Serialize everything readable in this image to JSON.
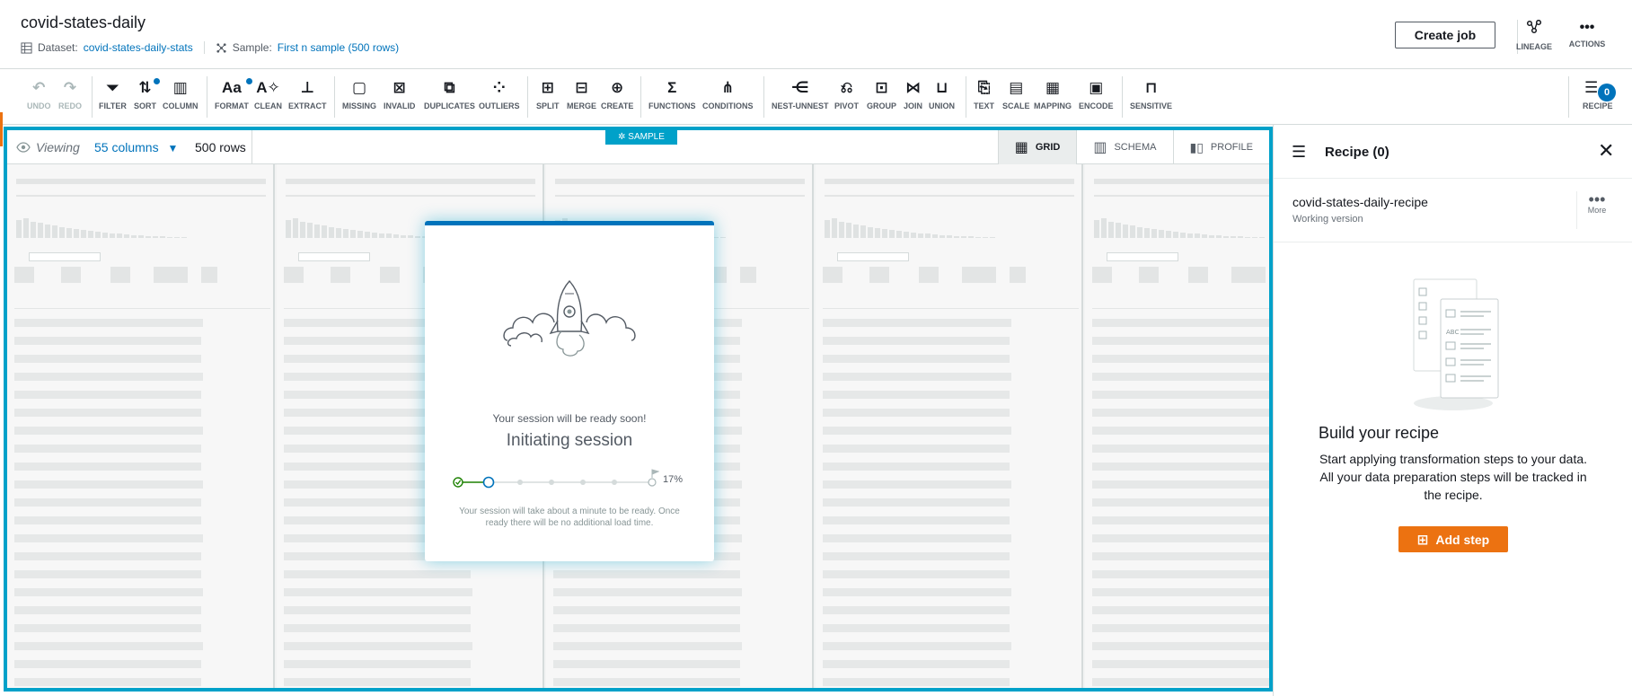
{
  "header": {
    "title": "covid-states-daily",
    "dataset_label": "Dataset:",
    "dataset_value": "covid-states-daily-stats",
    "sample_label": "Sample:",
    "sample_value": "First n sample (500 rows)",
    "create_job": "Create job",
    "lineage": "LINEAGE",
    "actions": "ACTIONS"
  },
  "toolbar": {
    "undo": "UNDO",
    "redo": "REDO",
    "filter": "FILTER",
    "sort": "SORT",
    "column": "COLUMN",
    "format": "FORMAT",
    "clean": "CLEAN",
    "extract": "EXTRACT",
    "missing": "MISSING",
    "invalid": "INVALID",
    "duplicates": "DUPLICATES",
    "outliers": "OUTLIERS",
    "split": "SPLIT",
    "merge": "MERGE",
    "create": "CREATE",
    "functions": "FUNCTIONS",
    "conditions": "CONDITIONS",
    "nest_unnest": "NEST-UNNEST",
    "pivot": "PIVOT",
    "group": "GROUP",
    "join": "JOIN",
    "union": "UNION",
    "text": "TEXT",
    "scale": "SCALE",
    "mapping": "MAPPING",
    "encode": "ENCODE",
    "sensitive": "SENSITIVE",
    "recipe": "RECIPE",
    "recipe_count": "0"
  },
  "grid": {
    "viewing": "Viewing",
    "columns": "55 columns",
    "rows": "500 rows",
    "sample_tag": "SAMPLE",
    "tabs": [
      "GRID",
      "SCHEMA",
      "PROFILE"
    ],
    "active_tab": "GRID"
  },
  "session": {
    "ready_text": "Your session will be ready soon!",
    "state": "Initiating session",
    "progress": "17%",
    "progress_fraction": 0.17,
    "note": "Your session will take about a minute to be ready. Once ready there will be no additional load time."
  },
  "recipe": {
    "title": "Recipe (0)",
    "name": "covid-states-daily-recipe",
    "version": "Working version",
    "more": "More",
    "build_title": "Build your recipe",
    "build_desc": "Start applying transformation steps to your data. All your data preparation steps will be tracked in the recipe.",
    "add_step": "Add step"
  },
  "colors": {
    "accent": "#0073bb",
    "frame": "#00a1c9",
    "primary_button": "#ec7211",
    "success": "#1d8102"
  }
}
